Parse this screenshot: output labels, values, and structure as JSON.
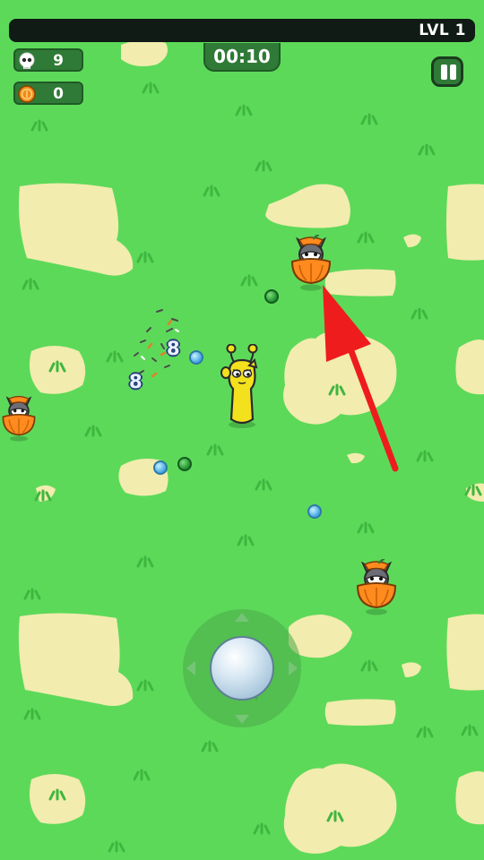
{
  "hud": {
    "level_label": "LVL 1",
    "xp_progress": 0,
    "kills": "9",
    "coins": "0",
    "timer": "00:10"
  },
  "icons": {
    "kills": "skull-icon",
    "coins": "coin-icon",
    "pause": "pause-icon"
  },
  "combat": {
    "damage_numbers": [
      "8",
      "8"
    ]
  },
  "colors": {
    "grass": "#5dd95a",
    "sand": "#f2ecae",
    "hud_panel": "#2f7a36",
    "arrow": "#ee1c1c",
    "player": "#f4e11e",
    "enemy_basket": "#ff8a1e"
  }
}
